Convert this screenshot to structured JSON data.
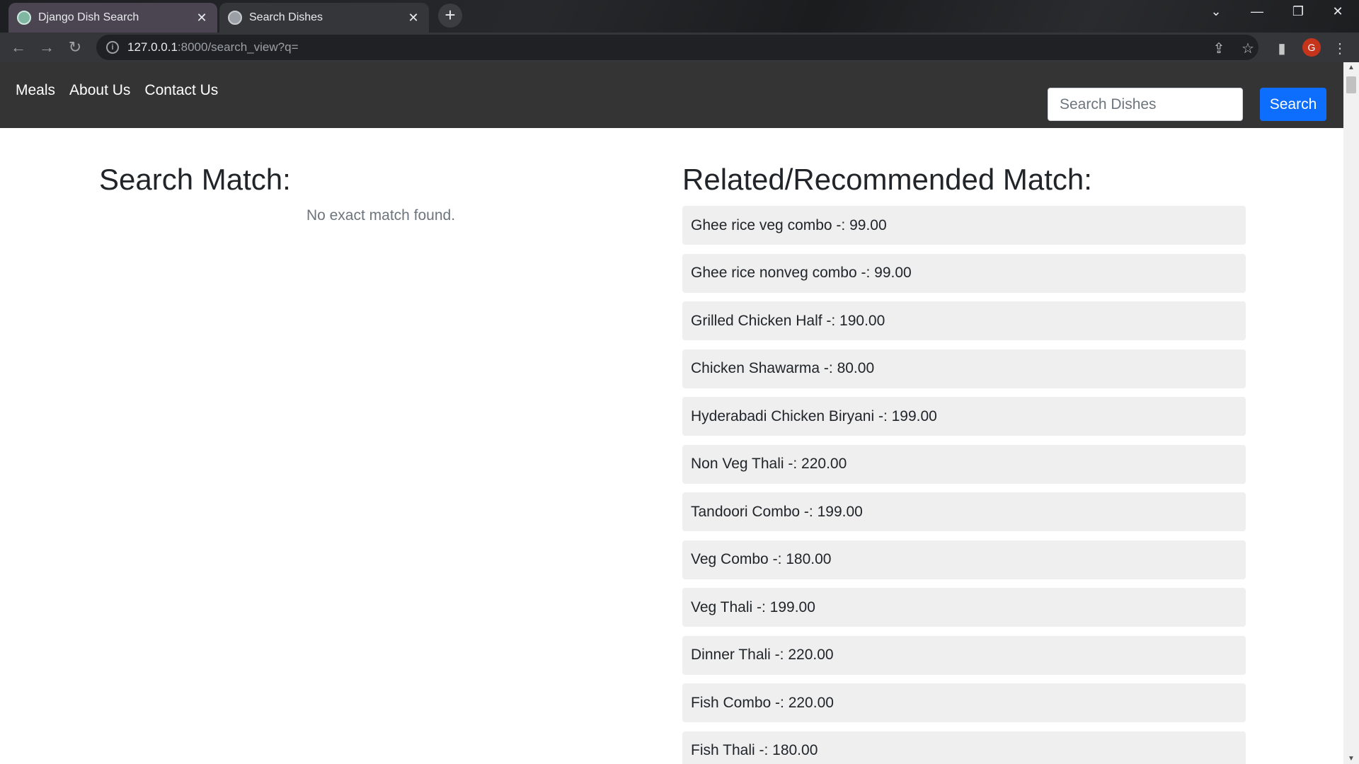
{
  "browser": {
    "tabs": [
      {
        "title": "Django Dish Search",
        "active": false
      },
      {
        "title": "Search Dishes",
        "active": true
      }
    ],
    "url_host": "127.0.0.1",
    "url_path": ":8000/search_view?q=",
    "profile_initial": "G"
  },
  "nav": {
    "links": [
      "Meals",
      "About Us",
      "Contact Us"
    ],
    "search_placeholder": "Search Dishes",
    "search_button": "Search"
  },
  "left": {
    "heading": "Search Match:",
    "empty_message": "No exact match found."
  },
  "right": {
    "heading": "Related/Recommended Match:",
    "items": [
      "Ghee rice veg combo -: 99.00",
      "Ghee rice nonveg combo -: 99.00",
      "Grilled Chicken Half -: 190.00",
      "Chicken Shawarma -: 80.00",
      "Hyderabadi Chicken Biryani -: 199.00",
      "Non Veg Thali -: 220.00",
      "Tandoori Combo -: 199.00",
      "Veg Combo -: 180.00",
      "Veg Thali -: 199.00",
      "Dinner Thali -: 220.00",
      "Fish Combo -: 220.00",
      "Fish Thali -: 180.00"
    ]
  },
  "colors": {
    "navbar": "#343434",
    "button": "#0d6efd",
    "list_item_bg": "#efefef"
  }
}
